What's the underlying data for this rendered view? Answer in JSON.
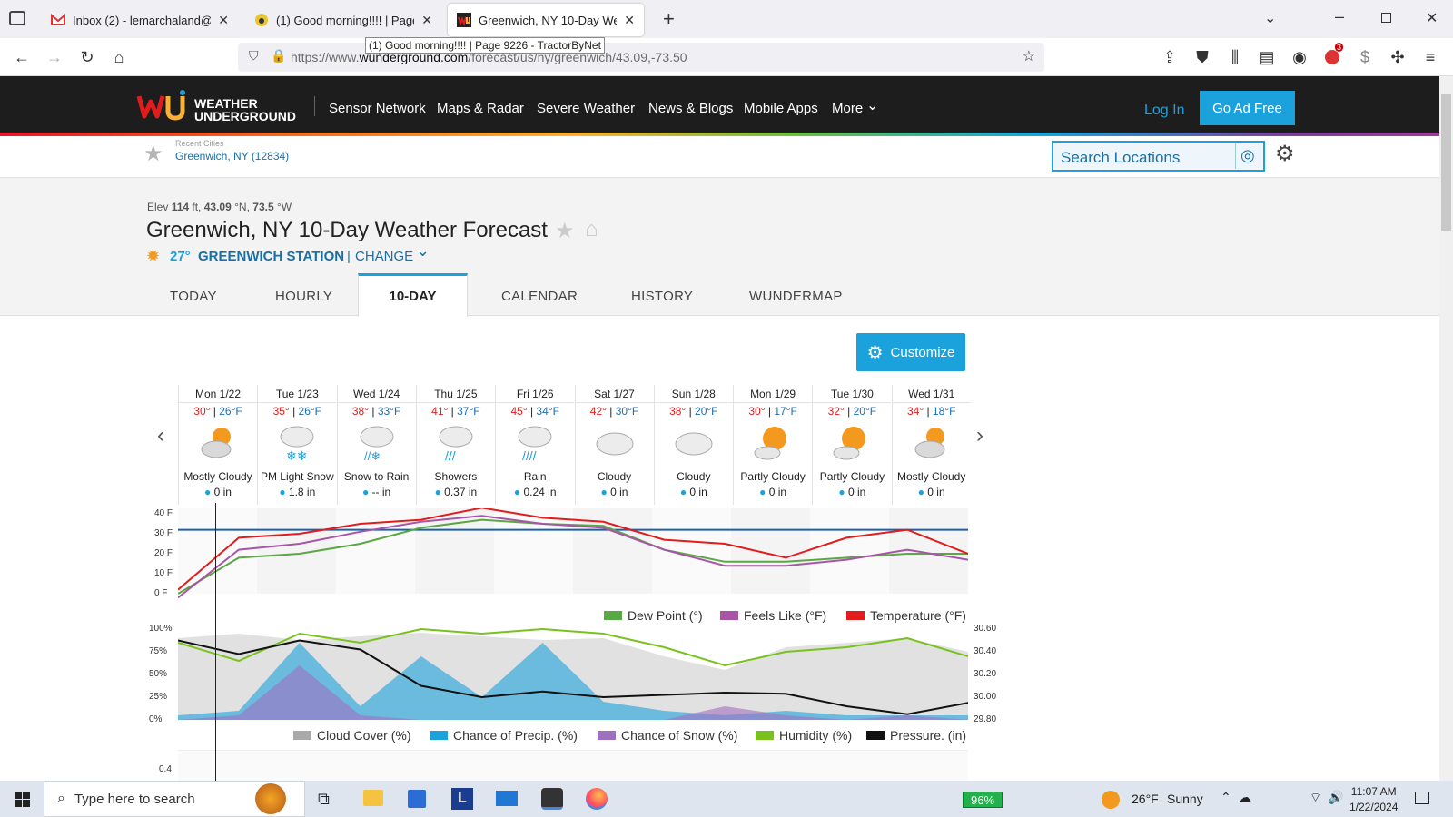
{
  "browser": {
    "tabs": [
      {
        "title": "Inbox (2) - lemarchaland@gma"
      },
      {
        "title": "(1) Good morning!!!! | Page 922"
      },
      {
        "title": "Greenwich, NY 10-Day Weather"
      }
    ],
    "tooltip": "(1) Good morning!!!! | Page 9226 - TractorByNet",
    "url_prefix": "https://www.",
    "url_domain": "wunderground.com",
    "url_path": "/forecast/us/ny/greenwich/43.09,-73.50",
    "extension_badge": "3"
  },
  "site": {
    "logo_line1": "WEATHER",
    "logo_line2": "UNDERGROUND",
    "nav": [
      "Sensor Network",
      "Maps & Radar",
      "Severe Weather",
      "News & Blogs",
      "Mobile Apps",
      "More"
    ],
    "login": "Log In",
    "go_ad_free": "Go Ad Free",
    "recent_cities_label": "Recent Cities",
    "recent_city": "Greenwich, NY (12834)",
    "search_placeholder": "Search Locations"
  },
  "page": {
    "elev_label": "Elev",
    "elev": "114",
    "elev_rest": "ft,",
    "lat": "43.09",
    "lat_unit": "°N,",
    "lon": "73.5",
    "lon_unit": "°W",
    "title": "Greenwich, NY 10-Day Weather Forecast",
    "current_temp": "27°",
    "station": "GREENWICH STATION",
    "separator": "|",
    "change": "CHANGE",
    "tabs": [
      "TODAY",
      "HOURLY",
      "10-DAY",
      "CALENDAR",
      "HISTORY",
      "WUNDERMAP"
    ],
    "customize": "Customize"
  },
  "forecast": [
    {
      "day": "Mon 1/22",
      "hi": "30°",
      "lo": "26°F",
      "cond": "Mostly Cloudy",
      "precip": "0 in",
      "icon": "partly-cloudy-sun-icon"
    },
    {
      "day": "Tue 1/23",
      "hi": "35°",
      "lo": "26°F",
      "cond": "PM Light Snow",
      "precip": "1.8 in",
      "icon": "snow-icon"
    },
    {
      "day": "Wed 1/24",
      "hi": "38°",
      "lo": "33°F",
      "cond": "Snow to Rain",
      "precip": "-- in",
      "icon": "snow-rain-icon"
    },
    {
      "day": "Thu 1/25",
      "hi": "41°",
      "lo": "37°F",
      "cond": "Showers",
      "precip": "0.37 in",
      "icon": "showers-icon"
    },
    {
      "day": "Fri 1/26",
      "hi": "45°",
      "lo": "34°F",
      "cond": "Rain",
      "precip": "0.24 in",
      "icon": "rain-icon"
    },
    {
      "day": "Sat 1/27",
      "hi": "42°",
      "lo": "30°F",
      "cond": "Cloudy",
      "precip": "0 in",
      "icon": "cloud-icon"
    },
    {
      "day": "Sun 1/28",
      "hi": "38°",
      "lo": "20°F",
      "cond": "Cloudy",
      "precip": "0 in",
      "icon": "cloud-icon"
    },
    {
      "day": "Mon 1/29",
      "hi": "30°",
      "lo": "17°F",
      "cond": "Partly Cloudy",
      "precip": "0 in",
      "icon": "sun-cloud-icon"
    },
    {
      "day": "Tue 1/30",
      "hi": "32°",
      "lo": "20°F",
      "cond": "Partly Cloudy",
      "precip": "0 in",
      "icon": "sun-cloud-icon"
    },
    {
      "day": "Wed 1/31",
      "hi": "34°",
      "lo": "18°F",
      "cond": "Mostly Cloudy",
      "precip": "0 in",
      "icon": "partly-cloudy-sun-icon"
    }
  ],
  "chart_data": [
    {
      "type": "line",
      "ylim": [
        0,
        40
      ],
      "yticks": [
        "40 F",
        "30 F",
        "20 F",
        "10 F",
        "0 F"
      ],
      "series": [
        {
          "name": "Dew Point (°)",
          "color": "#5aa843",
          "values": [
            0,
            18,
            20,
            25,
            33,
            37,
            35,
            34,
            22,
            16,
            16,
            18,
            20,
            20
          ]
        },
        {
          "name": "Feels Like (°F)",
          "color": "#a855a8",
          "values": [
            -2,
            22,
            25,
            31,
            36,
            39,
            35,
            33,
            22,
            14,
            14,
            17,
            22,
            17
          ]
        },
        {
          "name": "Temperature (°F)",
          "color": "#e21c1c",
          "values": [
            2,
            28,
            30,
            35,
            37,
            43,
            38,
            36,
            27,
            25,
            18,
            28,
            32,
            20
          ]
        }
      ]
    },
    {
      "type": "area",
      "ylim_left": [
        0,
        100
      ],
      "ylim_right": [
        29.8,
        30.6
      ],
      "yticks_left": [
        "100%",
        "75%",
        "50%",
        "25%",
        "0%"
      ],
      "yticks_right": [
        "30.60",
        "30.40",
        "30.20",
        "30.00",
        "29.80"
      ],
      "series": [
        {
          "name": "Cloud Cover (%)",
          "color": "#a9a9a9",
          "values": [
            90,
            95,
            88,
            92,
            96,
            92,
            88,
            90,
            70,
            55,
            80,
            85,
            90,
            75
          ]
        },
        {
          "name": "Chance of Precip. (%)",
          "color": "#1ba1dc",
          "values": [
            5,
            10,
            85,
            15,
            70,
            25,
            85,
            20,
            10,
            5,
            10,
            5,
            5,
            5
          ]
        },
        {
          "name": "Chance of Snow (%)",
          "color": "#a070c0",
          "values": [
            0,
            5,
            60,
            5,
            0,
            0,
            0,
            0,
            0,
            15,
            5,
            0,
            5,
            0
          ]
        },
        {
          "name": "Humidity (%)",
          "color": "#79c21e",
          "values": [
            85,
            65,
            95,
            85,
            100,
            95,
            100,
            95,
            80,
            60,
            75,
            80,
            90,
            70
          ]
        },
        {
          "name": "Pressure. (in)",
          "color": "#111111",
          "values": [
            30.5,
            30.38,
            30.5,
            30.42,
            30.1,
            30.0,
            30.05,
            30.0,
            30.02,
            30.04,
            30.03,
            29.92,
            29.85,
            29.95
          ]
        }
      ]
    }
  ],
  "second_chart_tick": "0.4",
  "taskbar": {
    "search": "Type here to search",
    "battery": "96%",
    "weather_temp": "26°F",
    "weather_desc": "Sunny",
    "time": "11:07 AM",
    "date": "1/22/2024"
  }
}
